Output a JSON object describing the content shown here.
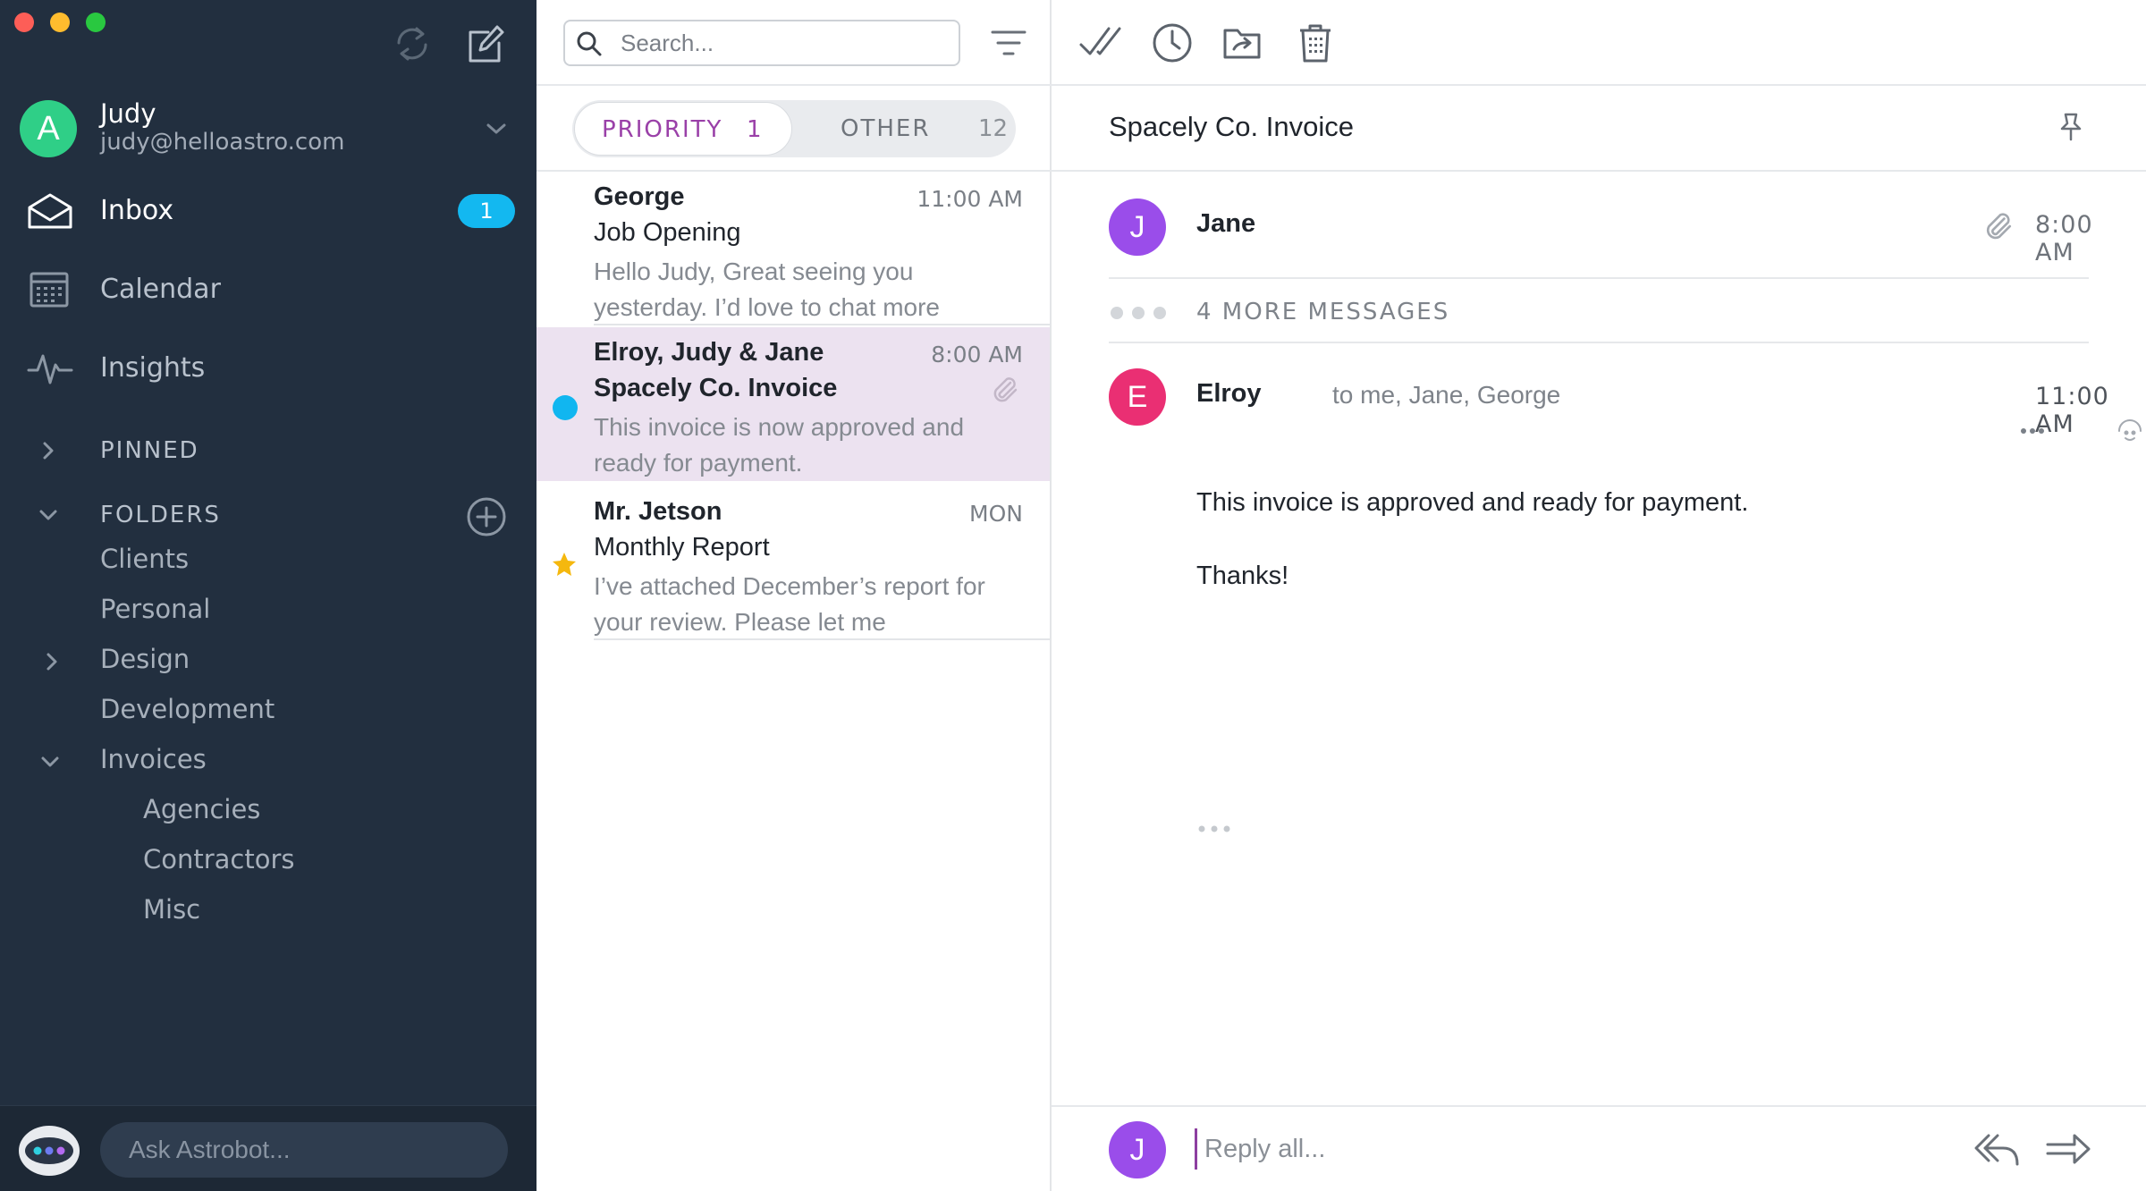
{
  "colors": {
    "sidebar_bg": "#222f3f",
    "accent_purple": "#9a40a8",
    "badge_blue": "#13b8f0",
    "selected_row": "#ece2f0",
    "avatar_judy": "#2fcf87",
    "avatar_jane": "#9a4dea",
    "avatar_elroy": "#ea2f73",
    "star": "#f5b80e"
  },
  "sidebar": {
    "account": {
      "initial": "A",
      "name": "Judy",
      "email": "judy@helloastro.com"
    },
    "nav": [
      {
        "label": "Inbox",
        "icon": "inbox-icon",
        "badge": "1"
      },
      {
        "label": "Calendar",
        "icon": "calendar-icon"
      },
      {
        "label": "Insights",
        "icon": "insights-icon"
      }
    ],
    "pinned_label": "PINNED",
    "folders_label": "FOLDERS",
    "folders": [
      {
        "label": "Clients"
      },
      {
        "label": "Personal"
      },
      {
        "label": "Design"
      },
      {
        "label": "Development"
      },
      {
        "label": "Invoices"
      },
      {
        "label": "Agencies"
      },
      {
        "label": "Contractors"
      },
      {
        "label": "Misc"
      }
    ],
    "astrobot_placeholder": "Ask Astrobot..."
  },
  "list": {
    "search_placeholder": "Search...",
    "tabs": {
      "priority": {
        "label": "PRIORITY",
        "count": "1"
      },
      "other": {
        "label": "OTHER",
        "count": "12"
      }
    },
    "messages": [
      {
        "from": "George",
        "time": "11:00 AM",
        "subject": "Job Opening",
        "preview": "Hello Judy, Great seeing you yesterday. I’d love to chat more"
      },
      {
        "from": "Elroy, Judy & Jane",
        "time": "8:00 AM",
        "subject": "Spacely Co. Invoice",
        "preview": "This invoice is now approved and ready for payment."
      },
      {
        "from": "Mr. Jetson",
        "time": "MON",
        "subject": "Monthly Report",
        "preview": "I’ve attached December’s report for your review. Please let me"
      }
    ]
  },
  "thread": {
    "title": "Spacely Co. Invoice",
    "first": {
      "initial": "J",
      "name": "Jane",
      "time": "8:00 AM"
    },
    "more_label": "4 MORE MESSAGES",
    "latest": {
      "initial": "E",
      "name": "Elroy",
      "to": "to me, Jane, George",
      "time": "11:00 AM",
      "body": [
        "This invoice is approved and ready for payment.",
        "Thanks!"
      ]
    },
    "reply": {
      "initial": "J",
      "placeholder": "Reply all..."
    }
  }
}
